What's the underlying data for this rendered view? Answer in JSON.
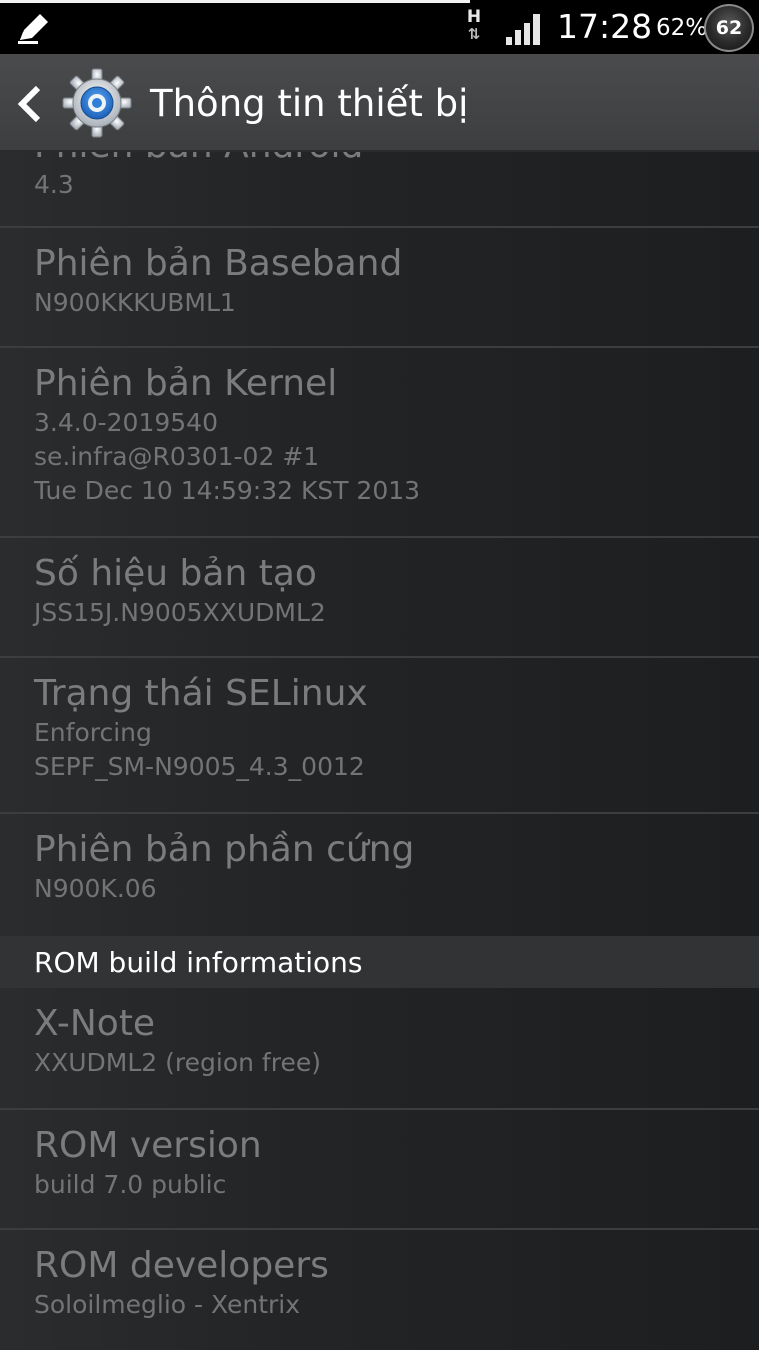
{
  "status_bar": {
    "network_type": "H",
    "network_arrows": "⇅",
    "time": "17:28",
    "battery_percent": "62%",
    "battery_badge": "62",
    "icons": [
      "pencil-icon",
      "signal-icon"
    ]
  },
  "action_bar": {
    "title": "Thông tin thiết bị",
    "icons": [
      "back-icon",
      "settings-gear-icon"
    ]
  },
  "list": {
    "items": [
      {
        "title": "Phiên bản Android",
        "value": "4.3"
      },
      {
        "title": "Phiên bản Baseband",
        "value": "N900KKKUBML1"
      },
      {
        "title": "Phiên bản Kernel",
        "value": "3.4.0-2019540\nse.infra@R0301-02 #1\nTue Dec 10 14:59:32 KST 2013"
      },
      {
        "title": "Số hiệu bản tạo",
        "value": "JSS15J.N9005XXUDML2"
      },
      {
        "title": "Trạng thái SELinux",
        "value": "Enforcing\nSEPF_SM-N9005_4.3_0012"
      },
      {
        "title": "Phiên bản phần cứng",
        "value": "N900K.06"
      }
    ],
    "section_header": "ROM build informations",
    "rom_items": [
      {
        "title": "X-Note",
        "value": "XXUDML2 (region free)"
      },
      {
        "title": "ROM version",
        "value": "build 7.0 public"
      },
      {
        "title": "ROM developers",
        "value": "Soloilmeglio - Xentrix"
      }
    ]
  },
  "colors": {
    "status_bar_bg": "#000000",
    "action_bar_bg": "#444547",
    "list_bg": "#242628",
    "item_text": "#7c7c7c",
    "section_bg": "#323335",
    "gear_blue": "#2f7fd8"
  }
}
